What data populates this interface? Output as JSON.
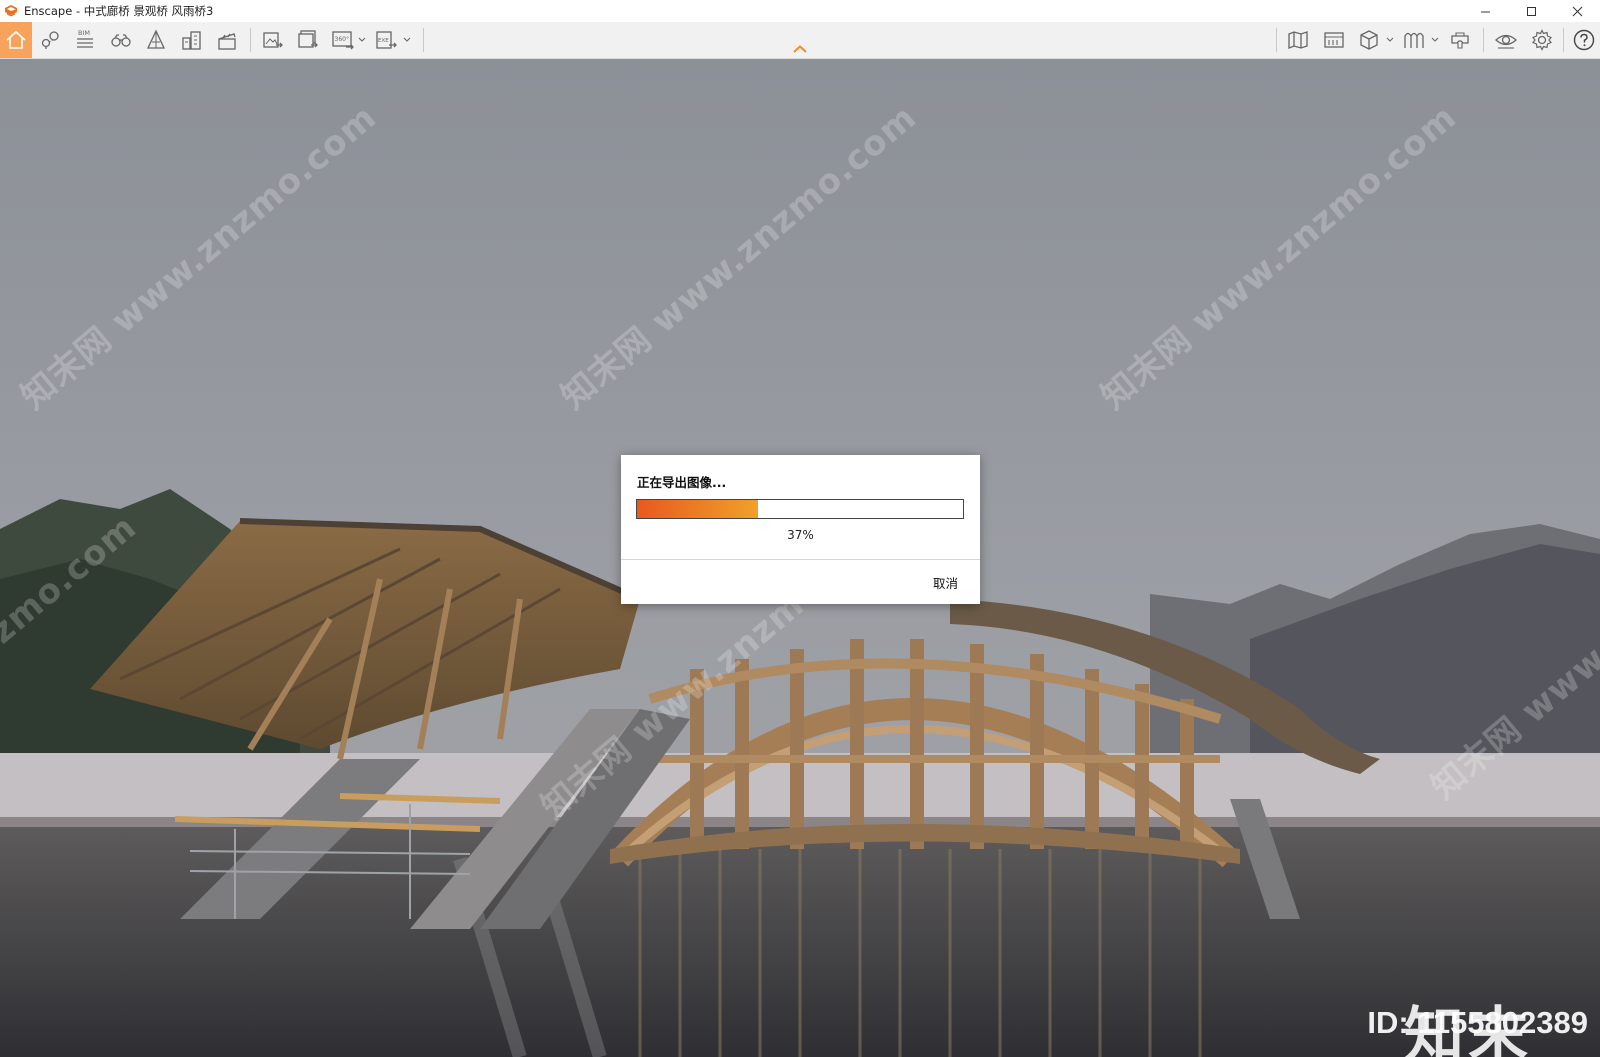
{
  "window": {
    "title": "Enscape - 中式廊桥 景观桥 风雨桥3",
    "controls": [
      "minimize-icon",
      "maximize-icon",
      "close-icon"
    ]
  },
  "toolbar": {
    "left_tools": [
      "home-icon",
      "location-pin-icon",
      "bim-list-icon",
      "binoculars-icon",
      "perspective-icon",
      "buildings-icon",
      "clapper-icon",
      "export-screenshot-icon",
      "batch-render-icon",
      "panorama-360-icon",
      "export-exe-icon"
    ],
    "bim_label": "BIM",
    "pano_label": "360°",
    "exe_label": "EXE",
    "right_tools": [
      "map-icon",
      "asset-library-icon",
      "cube-view-icon",
      "arches-icon",
      "vr-headset-icon",
      "eye-icon",
      "settings-gear-icon",
      "help-icon"
    ],
    "accent_color": "#f7a35b"
  },
  "export_dialog": {
    "title": "正在导出图像...",
    "progress": 0.37,
    "percent_label": "37%",
    "cancel_label": "取消"
  },
  "overlay": {
    "watermark_text": "知末网 www.znzmo.com",
    "brand_logo": "知末",
    "image_id": "ID: 1155802389"
  }
}
